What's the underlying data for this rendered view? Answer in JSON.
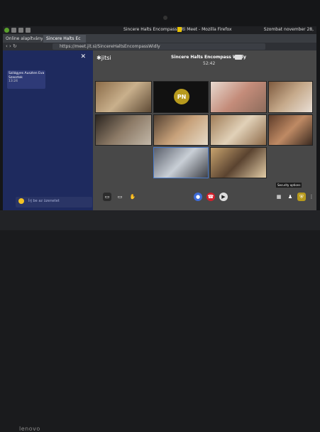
{
  "os": {
    "window_title_left": "Sincere Halts Encompass",
    "window_title_hl": "  ",
    "window_title_right": "Iti Meet - Mozilla Firefox",
    "tray_text": "Szombat november 28,"
  },
  "browser": {
    "tabs": [
      {
        "label": "Online alapítvány"
      },
      {
        "label": "Sincere Halts Ec"
      }
    ],
    "url": "https://meet.jit.si/SincereHaltsEncompassWidly"
  },
  "chat": {
    "message_sender": "Szilágyes Auszten Eva",
    "message_text": "Szasztok",
    "message_time": "13:24",
    "input_placeholder": "Írj be az üzenetet"
  },
  "meeting": {
    "brand": "jitsi",
    "name": "Sincere Halts Encompass Widly",
    "timer": "52:42"
  },
  "participants": [
    {
      "initials": ""
    },
    {
      "initials": "PN"
    },
    {
      "initials": ""
    },
    {
      "initials": ""
    },
    {
      "initials": ""
    },
    {
      "initials": ""
    },
    {
      "initials": ""
    },
    {
      "initials": ""
    },
    {
      "initials": ""
    },
    {
      "initials": ""
    }
  ],
  "tooltip": "Security options",
  "colors": {
    "accent": "#1e2a5e",
    "hangup": "#d21f2b",
    "avatar": "#b79a1d"
  },
  "brand_logo": "lenovo"
}
